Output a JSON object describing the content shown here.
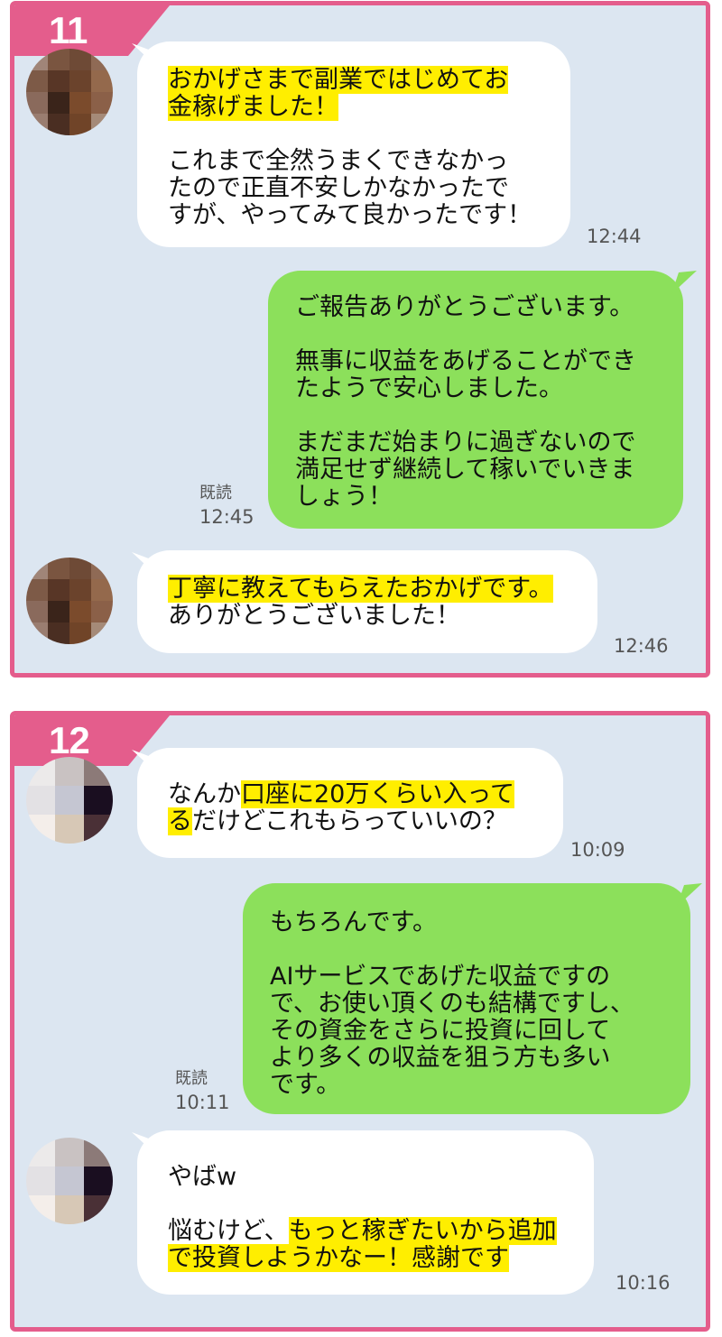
{
  "colors": {
    "frame": "#e45d8c",
    "background": "#dce6f1",
    "sent_bubble": "#8ce05b",
    "received_bubble": "#ffffff",
    "highlight": "#ffee00"
  },
  "panels": [
    {
      "number": "11",
      "messages": [
        {
          "lines": [
            "おかげさまで副業ではじめてお",
            "金稼げました！",
            "",
            "これまで全然うまくできなかっ",
            "たので正直不安しかなかったで",
            "すが、やってみて良かったです！"
          ],
          "time": "12:44"
        },
        {
          "lines": [
            "ご報告ありがとうございます。",
            "",
            "無事に収益をあげることができ",
            "たようで安心しました。",
            "",
            "まだまだ始まりに過ぎないので",
            "満足せず継続して稼いでいきま",
            "しょう！"
          ],
          "read": "既読",
          "time": "12:45"
        },
        {
          "lines": [
            "丁寧に教えてもらえたおかげです。",
            "ありがとうございました！"
          ],
          "time": "12:46"
        }
      ]
    },
    {
      "number": "12",
      "messages": [
        {
          "line1_pre": "なんか",
          "line1_hl": "口座に20万くらい入って",
          "line2_hl": "る",
          "line2_post": "だけどこれもらっていいの？",
          "time": "10:09"
        },
        {
          "lines": [
            "もちろんです。",
            "",
            "AIサービスであげた収益ですの",
            "で、お使い頂くのも結構ですし、",
            "その資金をさらに投資に回して",
            "より多くの収益を狙う方も多い",
            "です。"
          ],
          "read": "既読",
          "time": "10:11"
        },
        {
          "line1": "やばw",
          "line3_pre": "悩むけど、",
          "line3_hl": "もっと稼ぎたいから追加",
          "line4_hl": "で投資しようかなー！感謝です",
          "time": "10:16"
        }
      ]
    }
  ]
}
